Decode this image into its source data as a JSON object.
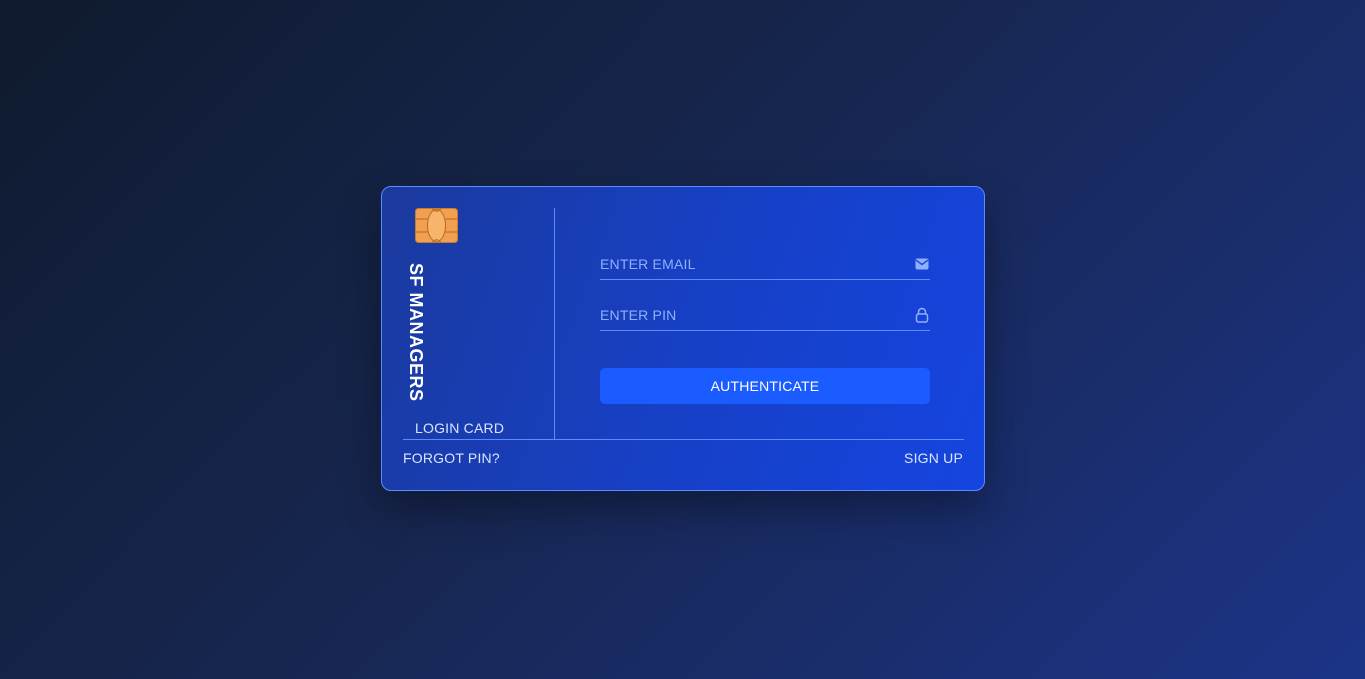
{
  "card": {
    "brand": "SF MANAGERS",
    "label": "LOGIN CARD",
    "chip_icon": "sim-chip-icon"
  },
  "form": {
    "email_placeholder": "ENTER EMAIL",
    "email_value": "",
    "email_icon": "envelope-icon",
    "pin_placeholder": "ENTER PIN",
    "pin_value": "",
    "pin_icon": "lock-icon",
    "submit_label": "AUTHENTICATE"
  },
  "links": {
    "forgot": "FORGOT PIN?",
    "signup": "SIGN UP"
  },
  "colors": {
    "accent": "#1a5cff",
    "border": "#5b8cff",
    "chip": "#f0a050"
  }
}
